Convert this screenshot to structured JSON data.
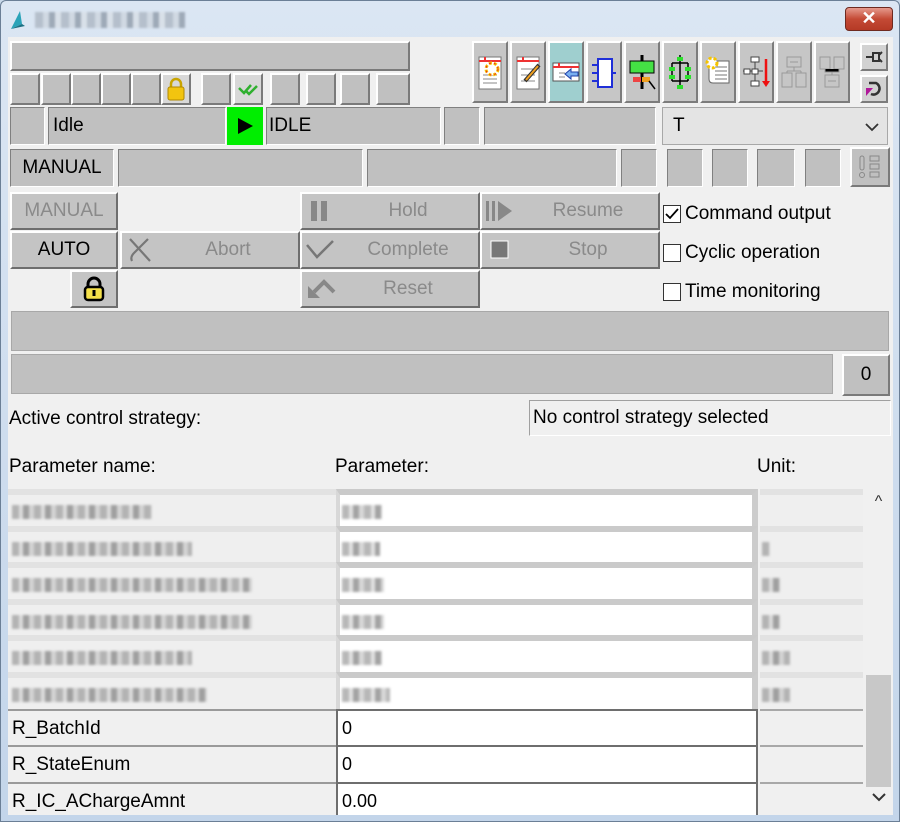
{
  "window": {
    "title": "(blurred)",
    "close_label": "✕"
  },
  "toolbar": {
    "icons": [
      "new-recipe-icon",
      "edit-recipe-icon",
      "import-recipe-icon",
      "block-icon",
      "operation-icon",
      "sequence-icon",
      "new-document-icon",
      "hierarchy-icon",
      "structure-disabled-icon",
      "structure-alt-disabled-icon"
    ],
    "active_index": 2,
    "pin_icon": "pin-icon",
    "undo_icon": "undo-icon"
  },
  "status_row": {
    "state_text": "Idle",
    "state_indicator_color": "#00ee00",
    "state_code": "IDLE",
    "dropdown_value": "T"
  },
  "mode_row": {
    "mode_label": "MANUAL"
  },
  "controls": {
    "manual_label": "MANUAL",
    "auto_label": "AUTO",
    "hold_label": "Hold",
    "resume_label": "Resume",
    "abort_label": "Abort",
    "complete_label": "Complete",
    "stop_label": "Stop",
    "reset_label": "Reset"
  },
  "options": {
    "command_output": {
      "label": "Command output",
      "checked": true
    },
    "cyclic_operation": {
      "label": "Cyclic operation",
      "checked": false
    },
    "time_monitoring": {
      "label": "Time monitoring",
      "checked": false
    }
  },
  "counter_button": "0",
  "strategy": {
    "label": "Active control strategy:",
    "value": "No control strategy selected"
  },
  "params": {
    "headers": {
      "name": "Parameter name:",
      "value": "Parameter:",
      "unit": "Unit:"
    },
    "blurred_rows": 6,
    "rows": [
      {
        "name": "R_BatchId",
        "value": "0",
        "unit": ""
      },
      {
        "name": "R_StateEnum",
        "value": "0",
        "unit": ""
      },
      {
        "name": "R_IC_AChargeAmnt",
        "value": "0.00",
        "unit": ""
      }
    ]
  }
}
